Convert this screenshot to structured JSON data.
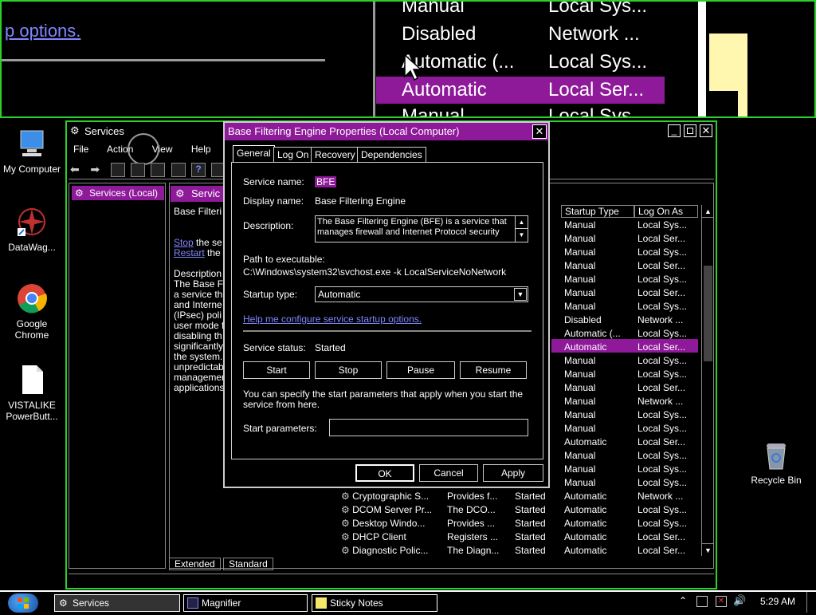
{
  "magnifier": {
    "link_text": "p options.",
    "rows": [
      {
        "startup": "Manual",
        "logon": "Local Sys..."
      },
      {
        "startup": "Disabled",
        "logon": "Network ..."
      },
      {
        "startup": "Automatic (...",
        "logon": "Local Sys..."
      },
      {
        "startup": "Automatic",
        "logon": "Local Ser..."
      },
      {
        "startup": "Manual",
        "logon": "Local Sys..."
      }
    ]
  },
  "desktop": {
    "icons": [
      {
        "label": "My Computer"
      },
      {
        "label": "DataWag..."
      },
      {
        "label": "Google Chrome"
      },
      {
        "label": "VISTALIKE PowerButt..."
      },
      {
        "label": "Recycle Bin"
      }
    ]
  },
  "services": {
    "title": "Services",
    "menu": [
      "File",
      "Action",
      "View",
      "Help"
    ],
    "tree_item": "Services (Local)",
    "header": "Servic",
    "desc_lines": [
      "Base Filteri",
      "",
      "Stop the se",
      "Restart the",
      "",
      "Description",
      "The Base F",
      "a service th",
      "and Interne",
      "(IPsec) poli",
      "user mode f",
      "disabling th",
      "significantly",
      "the system.",
      "unpredictab",
      "managemen",
      "applications"
    ],
    "stop_link": "Stop",
    "restart_link": "Restart",
    "col_startup": "Startup Type",
    "col_logon": "Log On As",
    "rows_right": [
      {
        "startup": "Manual",
        "logon": "Local Sys..."
      },
      {
        "startup": "Manual",
        "logon": "Local Ser..."
      },
      {
        "startup": "Manual",
        "logon": "Local Sys..."
      },
      {
        "startup": "Manual",
        "logon": "Local Ser..."
      },
      {
        "startup": "Manual",
        "logon": "Local Sys..."
      },
      {
        "startup": "Manual",
        "logon": "Local Ser..."
      },
      {
        "startup": "Manual",
        "logon": "Local Sys..."
      },
      {
        "startup": "Disabled",
        "logon": "Network ..."
      },
      {
        "startup": "Automatic (...",
        "logon": "Local Sys..."
      },
      {
        "startup": "Automatic",
        "logon": "Local Ser..."
      },
      {
        "startup": "Manual",
        "logon": "Local Sys..."
      },
      {
        "startup": "Manual",
        "logon": "Local Sys..."
      },
      {
        "startup": "Manual",
        "logon": "Local Ser..."
      },
      {
        "startup": "Manual",
        "logon": "Network ..."
      },
      {
        "startup": "Manual",
        "logon": "Local Sys..."
      },
      {
        "startup": "Manual",
        "logon": "Local Sys..."
      },
      {
        "startup": "Automatic",
        "logon": "Local Ser..."
      },
      {
        "startup": "Manual",
        "logon": "Local Sys..."
      },
      {
        "startup": "Manual",
        "logon": "Local Sys..."
      },
      {
        "startup": "Manual",
        "logon": "Local Sys..."
      }
    ],
    "rows_full": [
      {
        "name": "Cryptographic S...",
        "desc": "Provides f...",
        "status": "Started",
        "startup": "Automatic",
        "logon": "Network ..."
      },
      {
        "name": "DCOM Server Pr...",
        "desc": "The DCO...",
        "status": "Started",
        "startup": "Automatic",
        "logon": "Local Sys..."
      },
      {
        "name": "Desktop Windo...",
        "desc": "Provides ...",
        "status": "Started",
        "startup": "Automatic",
        "logon": "Local Sys..."
      },
      {
        "name": "DHCP Client",
        "desc": "Registers ...",
        "status": "Started",
        "startup": "Automatic",
        "logon": "Local Ser..."
      },
      {
        "name": "Diagnostic Polic...",
        "desc": "The Diagn...",
        "status": "Started",
        "startup": "Automatic",
        "logon": "Local Ser..."
      }
    ],
    "tab_extended": "Extended",
    "tab_standard": "Standard"
  },
  "dialog": {
    "title": "Base Filtering Engine Properties (Local Computer)",
    "tabs": [
      "General",
      "Log On",
      "Recovery",
      "Dependencies"
    ],
    "service_name_label": "Service name:",
    "service_name": "BFE",
    "display_name_label": "Display name:",
    "display_name": "Base Filtering Engine",
    "description_label": "Description:",
    "description": "The Base Filtering Engine (BFE) is a service that manages firewall and Internet Protocol security",
    "path_label": "Path to executable:",
    "path": "C:\\Windows\\system32\\svchost.exe -k LocalServiceNoNetwork",
    "startup_label": "Startup type:",
    "startup_value": "Automatic",
    "help_link": "Help me configure service startup options.",
    "status_label": "Service status:",
    "status_value": "Started",
    "btn_start": "Start",
    "btn_stop": "Stop",
    "btn_pause": "Pause",
    "btn_resume": "Resume",
    "params_note": "You can specify the start parameters that apply when you start the service from here.",
    "params_label": "Start parameters:",
    "params_value": "",
    "btn_ok": "OK",
    "btn_cancel": "Cancel",
    "btn_apply": "Apply"
  },
  "taskbar": {
    "tasks": [
      "Services",
      "Magnifier",
      "Sticky Notes"
    ],
    "clock": "5:29 AM"
  },
  "colors": {
    "accent": "#8e1a9a",
    "frame": "#2bd12b",
    "link": "#7f86ff"
  }
}
